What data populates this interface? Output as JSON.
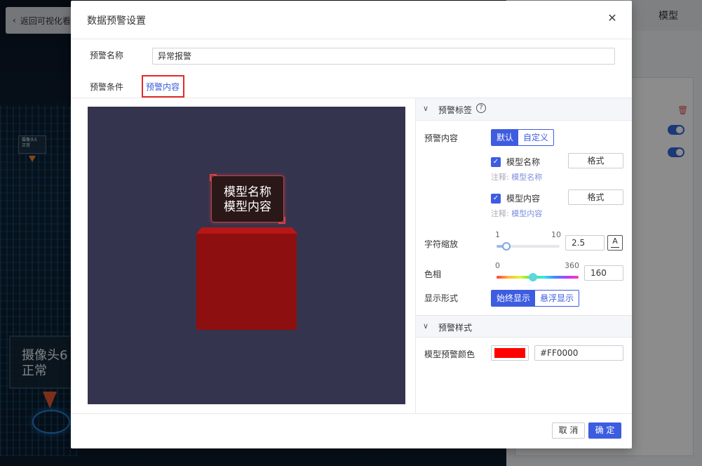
{
  "background": {
    "back_label": "返回可视化看",
    "model_tab": "模型",
    "camera_small_text": "摄像头5\n正常",
    "camera_label_line1": "摄像头6",
    "camera_label_line2": "正常"
  },
  "dialog": {
    "title": "数据预警设置",
    "close_icon": "close-icon",
    "name_label": "预警名称",
    "name_value": "异常报警",
    "tabs": [
      {
        "label": "预警条件",
        "active": false
      },
      {
        "label": "预警内容",
        "active": true
      }
    ],
    "preview": {
      "tag_line1": "模型名称",
      "tag_line2": "模型内容",
      "bg_color": "#35344E",
      "cube_color": "#8D0F10"
    },
    "section_label": {
      "title": "预警标签",
      "content_label": "预警内容",
      "content_options": [
        "默认",
        "自定义"
      ],
      "content_selected": "默认",
      "items": [
        {
          "checkbox_label": "模型名称",
          "checked": true,
          "format_label": "格式",
          "note_prefix": "注释:",
          "note_value": "模型名称"
        },
        {
          "checkbox_label": "模型内容",
          "checked": true,
          "format_label": "格式",
          "note_prefix": "注释:",
          "note_value": "模型内容"
        }
      ],
      "scale_label": "字符缩放",
      "scale_min": "1",
      "scale_max": "10",
      "scale_value": "2.5",
      "font_button": "A",
      "hue_label": "色相",
      "hue_min": "0",
      "hue_max": "360",
      "hue_value": "160",
      "display_label": "显示形式",
      "display_options": [
        "始终显示",
        "悬浮显示"
      ],
      "display_selected": "始终显示"
    },
    "section_style": {
      "title": "预警样式",
      "color_label": "模型预警颜色",
      "color_value": "#FF0000"
    },
    "buttons": {
      "cancel": "取 消",
      "ok": "确 定"
    }
  },
  "colors": {
    "primary": "#3D5CE0",
    "highlight_outline": "#E22A2A"
  }
}
